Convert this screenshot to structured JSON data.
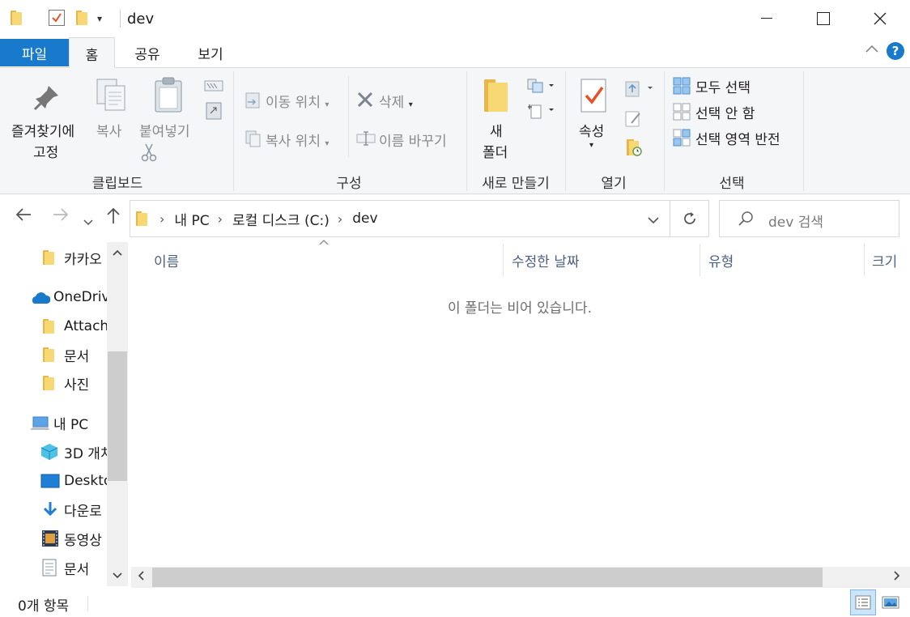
{
  "window": {
    "title": "dev"
  },
  "tabs": {
    "file": "파일",
    "home": "홈",
    "share": "공유",
    "view": "보기"
  },
  "ribbon": {
    "clipboard": {
      "pin_line1": "즐겨찾기에",
      "pin_line2": "고정",
      "copy": "복사",
      "paste": "붙여넣기",
      "group": "클립보드"
    },
    "organize": {
      "move_to": "이동 위치",
      "copy_to": "복사 위치",
      "delete": "삭제",
      "rename": "이름 바꾸기",
      "group": "구성"
    },
    "new": {
      "new_folder_line1": "새",
      "new_folder_line2": "폴더",
      "group": "새로 만들기"
    },
    "open": {
      "properties": "속성",
      "group": "열기"
    },
    "select": {
      "select_all": "모두 선택",
      "select_none": "선택 안 함",
      "invert": "선택 영역 반전",
      "group": "선택"
    }
  },
  "address": {
    "crumbs": [
      "내 PC",
      "로컬 디스크 (C:)",
      "dev"
    ],
    "search_placeholder": "dev 검색"
  },
  "nav": {
    "items": [
      {
        "label": "카카오",
        "icon": "folder-icon"
      },
      {
        "label": "OneDriv",
        "icon": "onedrive-icon"
      },
      {
        "label": "Attach",
        "icon": "folder-icon"
      },
      {
        "label": "문서",
        "icon": "folder-icon"
      },
      {
        "label": "사진",
        "icon": "folder-icon"
      },
      {
        "label": "내 PC",
        "icon": "this-pc-icon"
      },
      {
        "label": "3D 개처",
        "icon": "3d-objects-icon"
      },
      {
        "label": "Deskto",
        "icon": "desktop-icon"
      },
      {
        "label": "다운로",
        "icon": "downloads-icon"
      },
      {
        "label": "동영상",
        "icon": "videos-icon"
      },
      {
        "label": "문서",
        "icon": "documents-icon"
      }
    ]
  },
  "columns": {
    "name": "이름",
    "modified": "수정한 날짜",
    "type": "유형",
    "size": "크기"
  },
  "content": {
    "empty_message": "이 폴더는 비어 있습니다."
  },
  "status": {
    "item_count": "0개 항목"
  },
  "colors": {
    "accent": "#1979ca",
    "folder": "#f8d775"
  }
}
